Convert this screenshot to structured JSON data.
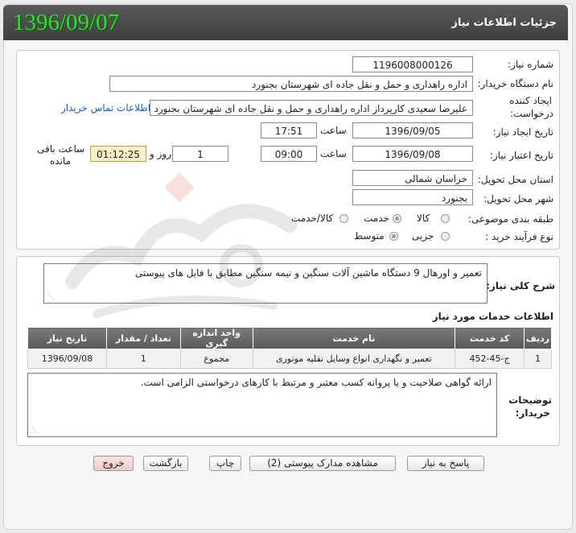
{
  "header": {
    "title": "جزئیات اطلاعات نیاز",
    "date_stamp": "1396/09/07"
  },
  "info": {
    "need_number_label": "شماره نیاز:",
    "need_number": "1196008000126",
    "buyer_label": "نام دستگاه خریدار:",
    "buyer": "اداره راهداری و حمل و نقل جاده ای شهرستان بجنورد",
    "creator_label_1": "ایجاد کننده",
    "creator_label_2": "درخواست:",
    "creator": "علیرضا سعیدی کارپرداز اداره راهداری و حمل و نقل جاده ای شهرستان بجنورد",
    "contact_link": "اطلاعات تماس خریدار",
    "created_label": "تاریخ ایجاد نیاز:",
    "created_date": "1396/09/05",
    "created_time_label": "ساعت",
    "created_time": "17:51",
    "valid_label": "تاریخ اعتبار نیاز:",
    "valid_date": "1396/09/08",
    "valid_time_label": "ساعت",
    "valid_time": "09:00",
    "days_value": "1",
    "days_label": "روز و",
    "remaining_time": "01:12:25",
    "remaining_label_1": "ساعت باقی",
    "remaining_label_2": "مانده",
    "province_label": "استان محل تحویل:",
    "province": "خراسان شمالی",
    "city_label": "شهر محل تحویل:",
    "city": "بجنورد",
    "category_label": "طبقه بندی موضوعی:",
    "category_options": [
      "کالا",
      "خدمت",
      "کالا/خدمت"
    ],
    "category_selected": "خدمت",
    "process_label": "نوع فرآیند خرید :",
    "process_options": [
      "جزیی",
      "متوسط"
    ],
    "process_selected": "متوسط"
  },
  "description": {
    "label": "شرح کلی نیاز:",
    "text": "تعمیر و اورهال 9 دستگاه ماشین آلات سنگین و نیمه سنگین مطابق با فایل های پیوستی"
  },
  "services": {
    "title": "اطلاعات خدمات مورد نیاز",
    "columns": [
      "ردیف",
      "کد خدمت",
      "نام خدمت",
      "واحد اندازه گیری",
      "تعداد / مقدار",
      "تاریخ نیاز"
    ],
    "rows": [
      [
        "1",
        "ج-45-452",
        "تعمیر و نگهداری انواع وسایل نقلیه موتوری",
        "مجموع",
        "1",
        "1396/09/08"
      ]
    ]
  },
  "buyer_notes": {
    "label_1": "توضیحات",
    "label_2": "خریدار:",
    "text": "ارائه گواهی صلاحیت و یا پروانه کسب معتبر و مرتبط با کارهای درخواستی الزامی است."
  },
  "buttons": {
    "reply": "پاسخ به نیاز",
    "attachments": "مشاهده مدارک پیوستی (2)",
    "print": "چاپ",
    "back": "بازگشت",
    "exit": "خروج"
  },
  "watermark_icon": "ahzareh-gostaran-watermark"
}
